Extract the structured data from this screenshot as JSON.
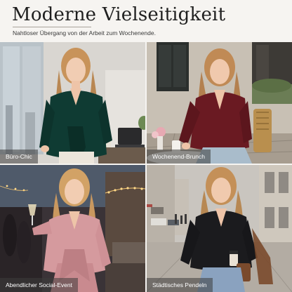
{
  "header": {
    "title": "Moderne Vielseitigkeit",
    "subtitle": "Nahtloser Übergang von der Arbeit zum Wochenende."
  },
  "panels": [
    {
      "caption": "Büro-Chic",
      "blouse_color": "#0f3b33"
    },
    {
      "caption": "Wochenend-Brunch",
      "blouse_color": "#6a1a22"
    },
    {
      "caption": "Abendlicher Social-Event",
      "blouse_color": "#d59a9e"
    },
    {
      "caption": "Städtisches Pendeln",
      "blouse_color": "#1b1b1e"
    }
  ]
}
